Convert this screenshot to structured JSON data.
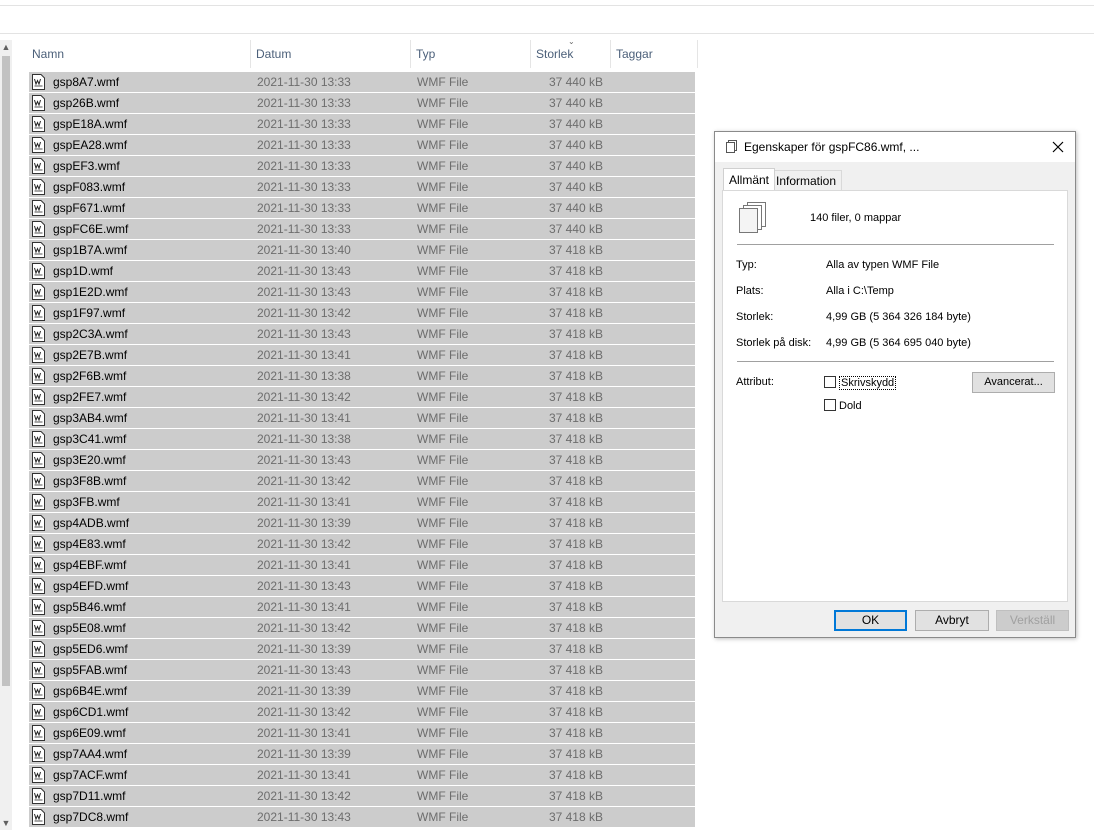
{
  "columns": {
    "name": "Namn",
    "date": "Datum",
    "type": "Typ",
    "size": "Storlek",
    "tags": "Taggar"
  },
  "files": [
    {
      "name": "gsp8A7.wmf",
      "date": "2021-11-30 13:33",
      "type": "WMF File",
      "size": "37 440 kB"
    },
    {
      "name": "gsp26B.wmf",
      "date": "2021-11-30 13:33",
      "type": "WMF File",
      "size": "37 440 kB"
    },
    {
      "name": "gspE18A.wmf",
      "date": "2021-11-30 13:33",
      "type": "WMF File",
      "size": "37 440 kB"
    },
    {
      "name": "gspEA28.wmf",
      "date": "2021-11-30 13:33",
      "type": "WMF File",
      "size": "37 440 kB"
    },
    {
      "name": "gspEF3.wmf",
      "date": "2021-11-30 13:33",
      "type": "WMF File",
      "size": "37 440 kB"
    },
    {
      "name": "gspF083.wmf",
      "date": "2021-11-30 13:33",
      "type": "WMF File",
      "size": "37 440 kB"
    },
    {
      "name": "gspF671.wmf",
      "date": "2021-11-30 13:33",
      "type": "WMF File",
      "size": "37 440 kB"
    },
    {
      "name": "gspFC6E.wmf",
      "date": "2021-11-30 13:33",
      "type": "WMF File",
      "size": "37 440 kB"
    },
    {
      "name": "gsp1B7A.wmf",
      "date": "2021-11-30 13:40",
      "type": "WMF File",
      "size": "37 418 kB"
    },
    {
      "name": "gsp1D.wmf",
      "date": "2021-11-30 13:43",
      "type": "WMF File",
      "size": "37 418 kB"
    },
    {
      "name": "gsp1E2D.wmf",
      "date": "2021-11-30 13:43",
      "type": "WMF File",
      "size": "37 418 kB"
    },
    {
      "name": "gsp1F97.wmf",
      "date": "2021-11-30 13:42",
      "type": "WMF File",
      "size": "37 418 kB"
    },
    {
      "name": "gsp2C3A.wmf",
      "date": "2021-11-30 13:43",
      "type": "WMF File",
      "size": "37 418 kB"
    },
    {
      "name": "gsp2E7B.wmf",
      "date": "2021-11-30 13:41",
      "type": "WMF File",
      "size": "37 418 kB"
    },
    {
      "name": "gsp2F6B.wmf",
      "date": "2021-11-30 13:38",
      "type": "WMF File",
      "size": "37 418 kB"
    },
    {
      "name": "gsp2FE7.wmf",
      "date": "2021-11-30 13:42",
      "type": "WMF File",
      "size": "37 418 kB"
    },
    {
      "name": "gsp3AB4.wmf",
      "date": "2021-11-30 13:41",
      "type": "WMF File",
      "size": "37 418 kB"
    },
    {
      "name": "gsp3C41.wmf",
      "date": "2021-11-30 13:38",
      "type": "WMF File",
      "size": "37 418 kB"
    },
    {
      "name": "gsp3E20.wmf",
      "date": "2021-11-30 13:43",
      "type": "WMF File",
      "size": "37 418 kB"
    },
    {
      "name": "gsp3F8B.wmf",
      "date": "2021-11-30 13:42",
      "type": "WMF File",
      "size": "37 418 kB"
    },
    {
      "name": "gsp3FB.wmf",
      "date": "2021-11-30 13:41",
      "type": "WMF File",
      "size": "37 418 kB"
    },
    {
      "name": "gsp4ADB.wmf",
      "date": "2021-11-30 13:39",
      "type": "WMF File",
      "size": "37 418 kB"
    },
    {
      "name": "gsp4E83.wmf",
      "date": "2021-11-30 13:42",
      "type": "WMF File",
      "size": "37 418 kB"
    },
    {
      "name": "gsp4EBF.wmf",
      "date": "2021-11-30 13:41",
      "type": "WMF File",
      "size": "37 418 kB"
    },
    {
      "name": "gsp4EFD.wmf",
      "date": "2021-11-30 13:43",
      "type": "WMF File",
      "size": "37 418 kB"
    },
    {
      "name": "gsp5B46.wmf",
      "date": "2021-11-30 13:41",
      "type": "WMF File",
      "size": "37 418 kB"
    },
    {
      "name": "gsp5E08.wmf",
      "date": "2021-11-30 13:42",
      "type": "WMF File",
      "size": "37 418 kB"
    },
    {
      "name": "gsp5ED6.wmf",
      "date": "2021-11-30 13:39",
      "type": "WMF File",
      "size": "37 418 kB"
    },
    {
      "name": "gsp5FAB.wmf",
      "date": "2021-11-30 13:43",
      "type": "WMF File",
      "size": "37 418 kB"
    },
    {
      "name": "gsp6B4E.wmf",
      "date": "2021-11-30 13:39",
      "type": "WMF File",
      "size": "37 418 kB"
    },
    {
      "name": "gsp6CD1.wmf",
      "date": "2021-11-30 13:42",
      "type": "WMF File",
      "size": "37 418 kB"
    },
    {
      "name": "gsp6E09.wmf",
      "date": "2021-11-30 13:41",
      "type": "WMF File",
      "size": "37 418 kB"
    },
    {
      "name": "gsp7AA4.wmf",
      "date": "2021-11-30 13:39",
      "type": "WMF File",
      "size": "37 418 kB"
    },
    {
      "name": "gsp7ACF.wmf",
      "date": "2021-11-30 13:41",
      "type": "WMF File",
      "size": "37 418 kB"
    },
    {
      "name": "gsp7D11.wmf",
      "date": "2021-11-30 13:42",
      "type": "WMF File",
      "size": "37 418 kB"
    },
    {
      "name": "gsp7DC8.wmf",
      "date": "2021-11-30 13:43",
      "type": "WMF File",
      "size": "37 418 kB"
    }
  ],
  "file_icon": "wmf-file-icon",
  "dialog": {
    "title": "Egenskaper för gspFC86.wmf, ...",
    "tabs": [
      "Allmänt",
      "Information"
    ],
    "summary": "140 filer, 0 mappar",
    "type_label": "Typ:",
    "type_value": "Alla av typen WMF File",
    "location_label": "Plats:",
    "location_value": "Alla i C:\\Temp",
    "size_label": "Storlek:",
    "size_value": "4,99 GB (5 364 326 184 byte)",
    "disk_size_label": "Storlek på disk:",
    "disk_size_value": "4,99 GB (5 364 695 040 byte)",
    "attributes_label": "Attribut:",
    "readonly_label": "Skrivskydd",
    "hidden_label": "Dold",
    "advanced_label": "Avancerat...",
    "ok_label": "OK",
    "cancel_label": "Avbryt",
    "apply_label": "Verkställ"
  },
  "colors": {
    "selection": "#cccccc",
    "header_text": "#4c607a",
    "default_button_border": "#0078d7"
  }
}
